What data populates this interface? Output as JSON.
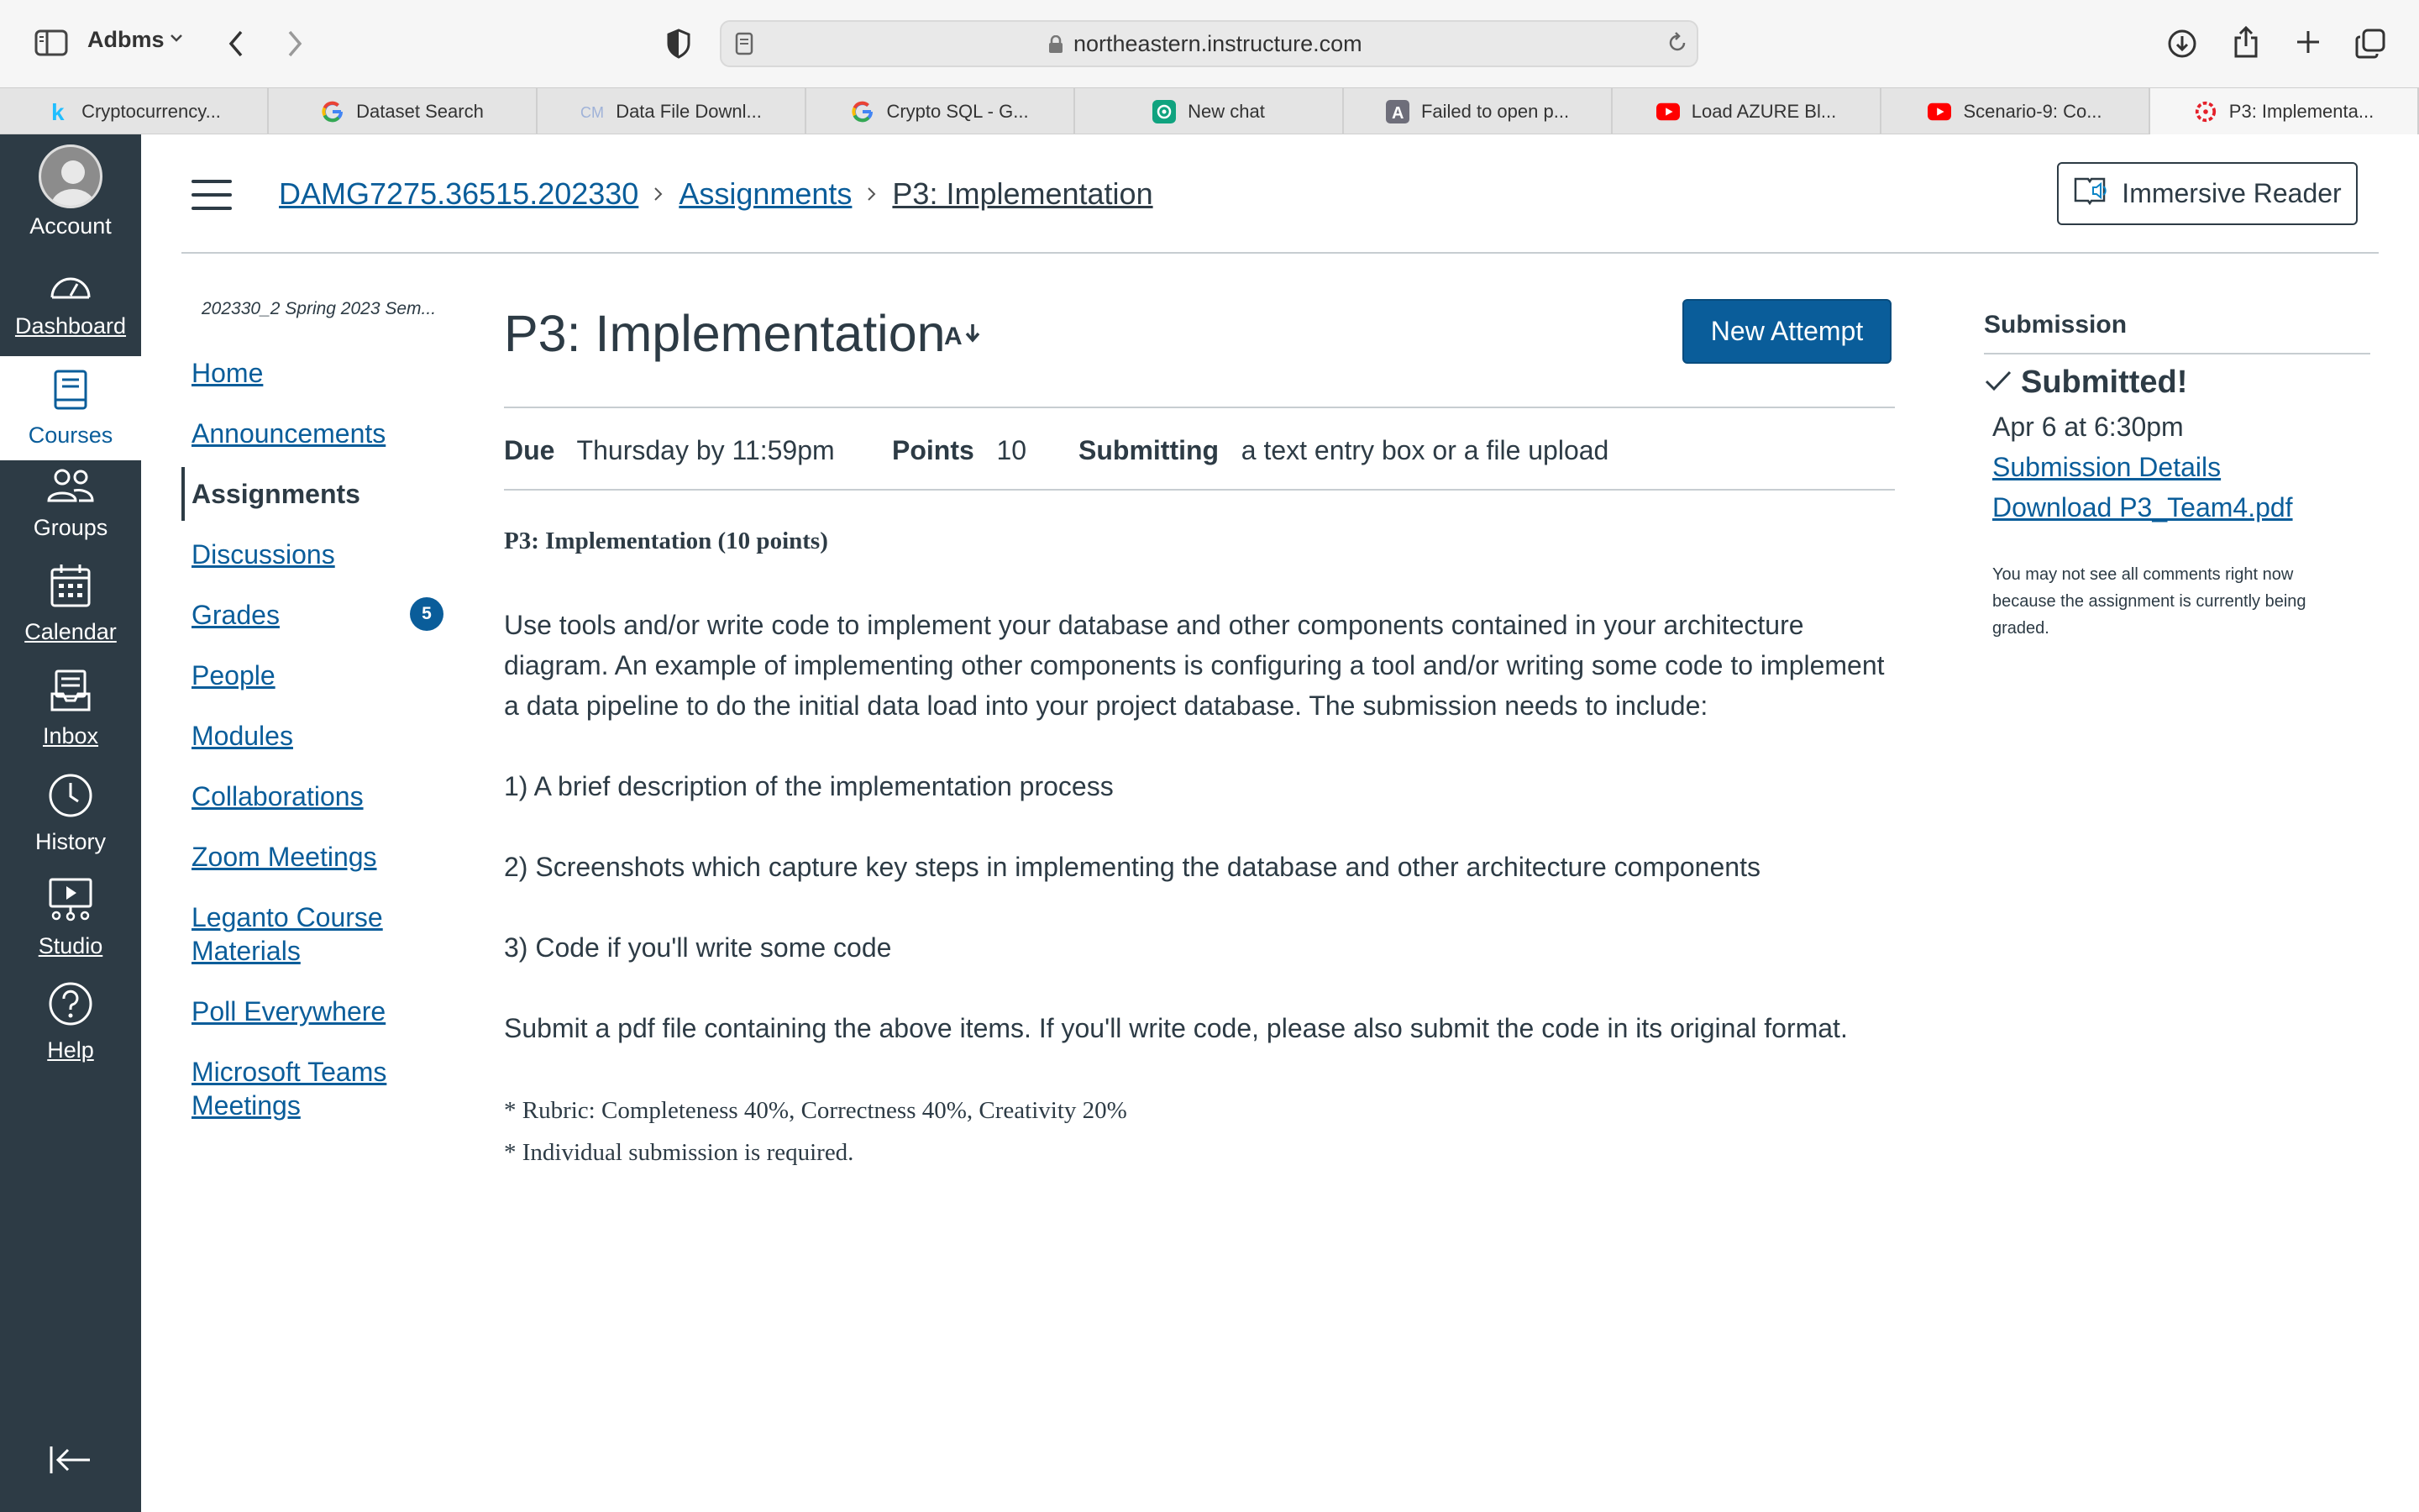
{
  "browser": {
    "profile": "Adbms",
    "url": "northeastern.instructure.com",
    "tabs": [
      {
        "label": "Cryptocurrency...",
        "icon": "kaggle-icon"
      },
      {
        "label": "Dataset Search",
        "icon": "google-icon"
      },
      {
        "label": "Data File Downl...",
        "icon": "cm-icon"
      },
      {
        "label": "Crypto SQL - G...",
        "icon": "google-icon"
      },
      {
        "label": "New chat",
        "icon": "chatgpt-icon"
      },
      {
        "label": "Failed to open p...",
        "icon": "letter-a-icon"
      },
      {
        "label": "Load AZURE Bl...",
        "icon": "youtube-icon"
      },
      {
        "label": "Scenario-9: Co...",
        "icon": "youtube-icon"
      },
      {
        "label": "P3: Implementa...",
        "icon": "canvas-icon",
        "active": true
      }
    ]
  },
  "global_nav": {
    "account": "Account",
    "dashboard": "Dashboard",
    "courses": "Courses",
    "groups": "Groups",
    "calendar": "Calendar",
    "inbox": "Inbox",
    "history": "History",
    "studio": "Studio",
    "help": "Help"
  },
  "header": {
    "breadcrumbs": [
      "DAMG7275.36515.202330",
      "Assignments",
      "P3: Implementation"
    ],
    "immersive_reader": "Immersive Reader"
  },
  "course_nav": {
    "term": "202330_2 Spring 2023 Sem...",
    "items": [
      "Home",
      "Announcements",
      "Assignments",
      "Discussions",
      "Grades",
      "People",
      "Modules",
      "Collaborations",
      "Zoom Meetings",
      "Leganto Course Materials",
      "Poll Everywhere",
      "Microsoft Teams Meetings"
    ],
    "leganto_line1": "Leganto Course",
    "leganto_line2": "Materials",
    "teams_line1": "Microsoft Teams",
    "teams_line2": "Meetings",
    "grades_badge": "5"
  },
  "assignment": {
    "title": "P3: Implementation",
    "new_attempt": "New Attempt",
    "due_label": "Due",
    "due_value": "Thursday by 11:59pm",
    "points_label": "Points",
    "points_value": "10",
    "submitting_label": "Submitting",
    "submitting_value": "a text entry box or a file upload",
    "subheading": "P3: Implementation (10 points)",
    "description": "Use tools and/or write code to implement your database and other components contained in your architecture diagram. An example of implementing other components is configuring a tool and/or writing some code to implement a data pipeline to do the initial data load into your project database. The submission needs to include:",
    "item1": "1) A brief description of the implementation process",
    "item2": "2) Screenshots which capture key steps in implementing the database and other architecture components",
    "item3": "3) Code if you'll write some code",
    "submit_note": "Submit a pdf file containing the above items. If you'll write code, please also submit the code in its original format.",
    "rubric": "* Rubric: Completeness 40%, Correctness 40%, Creativity 20%",
    "individual": "* Individual submission is required."
  },
  "submission": {
    "heading": "Submission",
    "status": "Submitted!",
    "date": "Apr 6 at 6:30pm",
    "details_link": "Submission Details",
    "download_link": "Download P3_Team4.pdf",
    "note": "You may not see all comments right now because the assignment is currently being graded."
  },
  "colors": {
    "nav_bg": "#2d3b45",
    "link": "#0a5d9a",
    "text": "#2d3b45",
    "primary_button": "#0a5d9a"
  }
}
